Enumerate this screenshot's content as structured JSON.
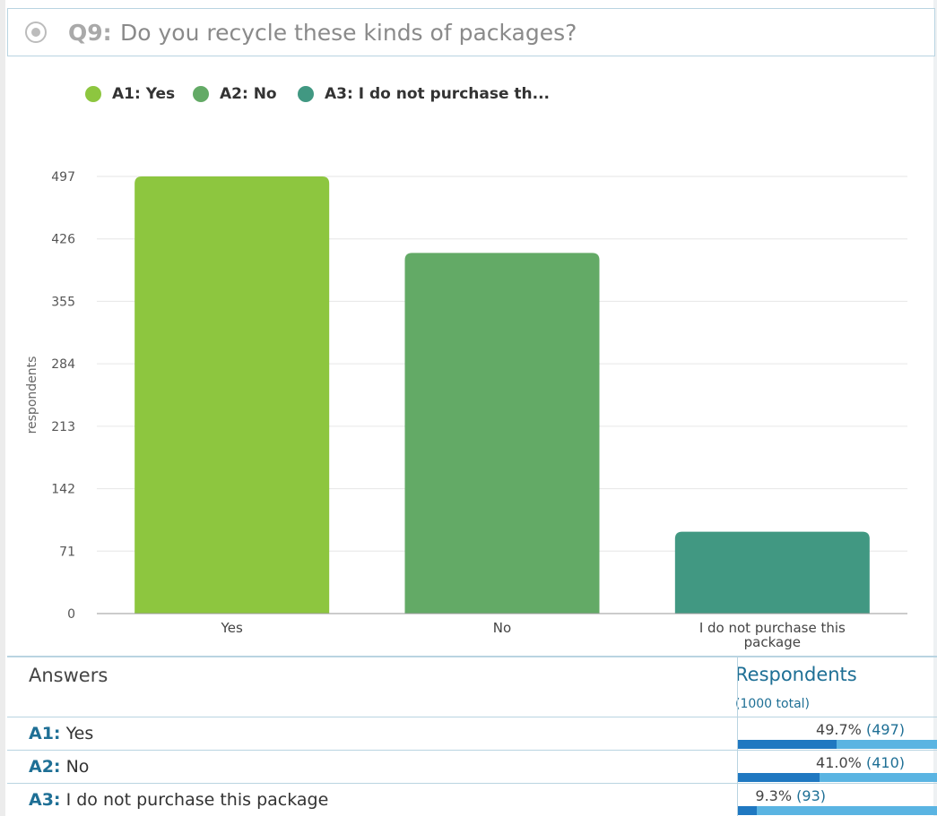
{
  "question": {
    "number": "Q9:",
    "text": "Do you recycle these kinds of packages?"
  },
  "legend": [
    {
      "label": "A1: Yes",
      "color": "#8dc63f"
    },
    {
      "label": "A2: No",
      "color": "#63aa66"
    },
    {
      "label": "A3: I do not purchase th...",
      "color": "#419882"
    }
  ],
  "chart_data": {
    "type": "bar",
    "categories": [
      "Yes",
      "No",
      "I do not purchase this package"
    ],
    "category_label_lines": [
      [
        "Yes"
      ],
      [
        "No"
      ],
      [
        "I do not purchase this",
        "package"
      ]
    ],
    "values": [
      497,
      410,
      93
    ],
    "colors": [
      "#8dc63f",
      "#63aa66",
      "#419882"
    ],
    "ylabel": "respondents",
    "yticks": [
      0,
      71,
      142,
      213,
      284,
      355,
      426,
      497
    ],
    "ylim": [
      0,
      497
    ],
    "grid": true
  },
  "table": {
    "header_answers": "Answers",
    "header_respondents": "Respondents",
    "total": "(1000 total)",
    "rows": [
      {
        "code": "A1:",
        "label": "Yes",
        "percent": "49.7%",
        "count": "(497)",
        "fraction": 0.497
      },
      {
        "code": "A2:",
        "label": "No",
        "percent": "41.0%",
        "count": "(410)",
        "fraction": 0.41
      },
      {
        "code": "A3:",
        "label": "I do not purchase this package",
        "percent": "9.3%",
        "count": "(93)",
        "fraction": 0.093
      }
    ]
  }
}
